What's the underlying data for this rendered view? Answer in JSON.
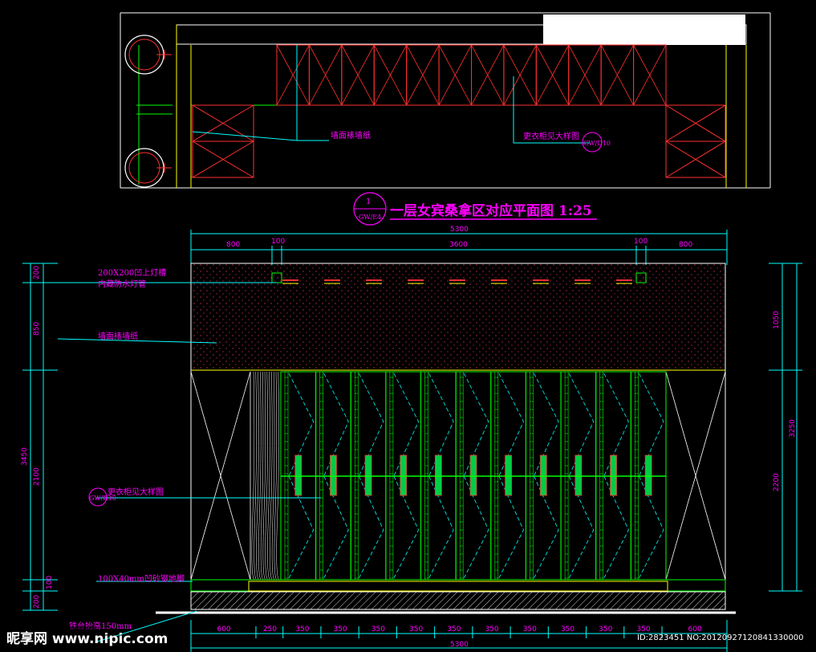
{
  "plan": {
    "title": "一层女宾桑拿区对应平面图 1:25",
    "index_number": "1",
    "index_sheet": "GW/E4",
    "label_wallpaper": "墙面裱墙纸",
    "label_locker": "更衣柜见大样图",
    "locker_tag": "GW/D10"
  },
  "elevation": {
    "top_dims": {
      "overall": "5300",
      "segments": [
        "800",
        "100",
        "3600",
        "100",
        "800"
      ]
    },
    "left_dims": [
      "200",
      "850",
      "3450",
      "2100",
      "200",
      "100"
    ],
    "right_dims": [
      "1050",
      "3250",
      "2200"
    ],
    "notes": {
      "light_trough_line1": "200X200凹上灯槽",
      "light_trough_line2": "内藏防水灯管",
      "wallpaper": "墙面裱墙纸",
      "locker": "更衣柜见大样图",
      "locker_tag": "GW/D10",
      "skirting": "100X40mm凹砂钢地脚",
      "platform_height": "铁台抬高150mm"
    },
    "bottom_dims": {
      "segments": [
        "600",
        "250",
        "350",
        "350",
        "350",
        "350",
        "350",
        "350",
        "350",
        "350",
        "350",
        "350",
        "600"
      ],
      "overall": "5300"
    }
  },
  "watermark": {
    "site": "昵享网 www.nipic.com",
    "image_id": "ID:2823451 NO:20120927120841330000"
  }
}
